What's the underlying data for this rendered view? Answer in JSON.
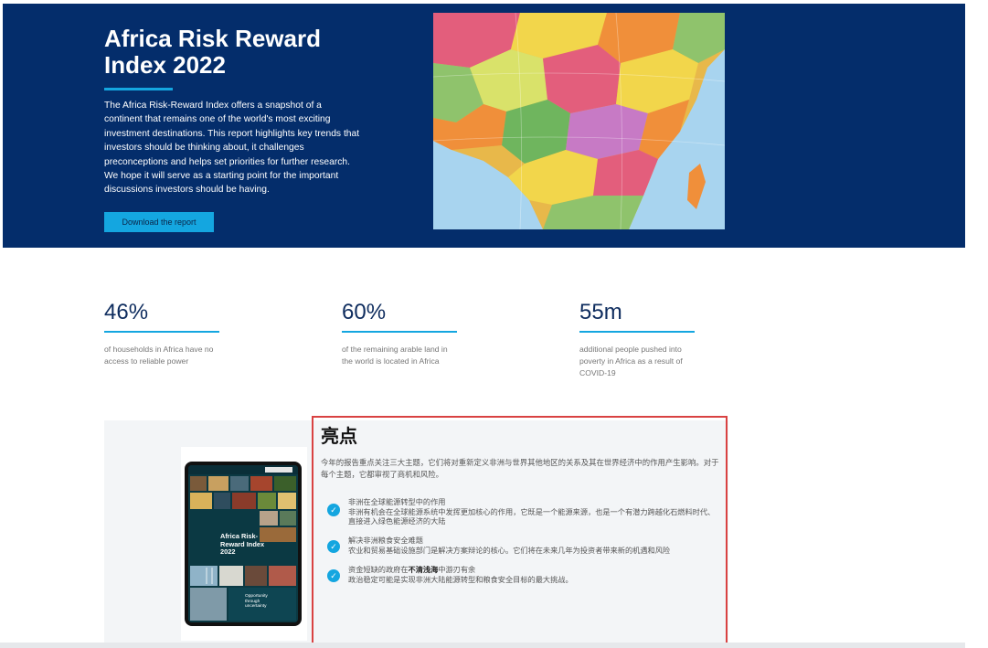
{
  "hero": {
    "title": "Africa Risk Reward Index 2022",
    "description": "The Africa Risk-Reward Index offers a snapshot of a continent that remains one of the world's most exciting investment destinations. This report highlights key trends that investors should be thinking about, it challenges preconceptions and helps set priorities for further research. We hope it will serve as a starting point for the important discussions investors should be having.",
    "button_label": "Download the report"
  },
  "stats": [
    {
      "value": "46%",
      "desc": "of households in Africa have no access to reliable power"
    },
    {
      "value": "60%",
      "desc": "of the remaining arable land in the world is located in Africa"
    },
    {
      "value": "55m",
      "desc": "additional people pushed into poverty in Africa as a result of COVID-19"
    }
  ],
  "report_cover": {
    "title": "Africa Risk-Reward Index 2022",
    "subtitle": "Opportunity through uncertainty"
  },
  "highlights": {
    "title": "亮点",
    "intro": "今年的报告重点关注三大主题，它们将对重新定义非洲与世界其他地区的关系及其在世界经济中的作用产生影响。对于每个主题，它都审视了商机和风险。",
    "items": [
      {
        "heading": "非洲在全球能源转型中的作用",
        "body": "非洲有机会在全球能源系统中发挥更加核心的作用，它既是一个能源来源，也是一个有潜力跨越化石燃料时代、直接进入绿色能源经济的大陆"
      },
      {
        "heading": "解决非洲粮食安全难题",
        "body": "农业和贸易基础设施部门是解决方案辩论的核心。它们将在未来几年为投资者带来新的机遇和风险"
      },
      {
        "heading_pre": "资金短缺的政府在",
        "heading_bold": "不清浅海",
        "heading_post": "中游刃有余",
        "body": "政治稳定可能是实现非洲大陆能源转型和粮食安全目标的最大挑战。"
      }
    ]
  },
  "colors": {
    "navy": "#042d6b",
    "accent": "#14a6e0",
    "highlight_border": "#d94242"
  }
}
